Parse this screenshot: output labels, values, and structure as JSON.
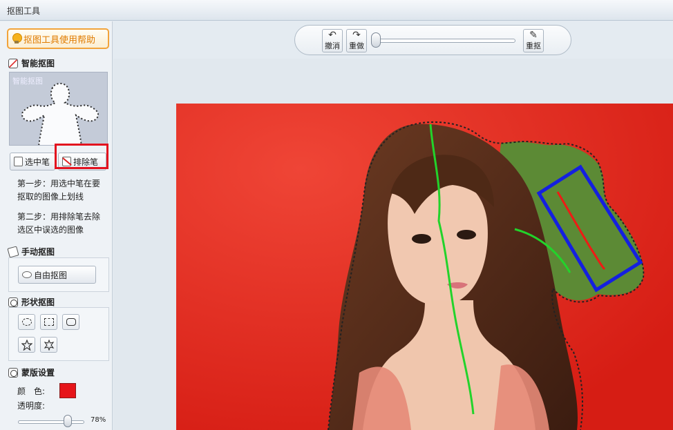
{
  "window": {
    "title": "抠图工具"
  },
  "sidebar": {
    "help_button": "抠图工具使用帮助",
    "smart": {
      "title": "智能抠图",
      "preview_label": "智能抠图",
      "select_pen": "选中笔",
      "exclude_pen": "排除笔",
      "step1": "第一步：用选中笔在要抠取的图像上划线",
      "step2": "第二步：用排除笔去除选区中误选的图像"
    },
    "manual": {
      "title": "手动抠图",
      "free_button": "自由抠图"
    },
    "shape": {
      "title": "形状抠图",
      "shapes": [
        "ellipse-icon",
        "rect-dashed-icon",
        "rounded-rect-icon",
        "star-icon",
        "star-outline-icon"
      ]
    },
    "mask": {
      "title": "蒙版设置",
      "color_label": "颜　色:",
      "color": "#e6151a",
      "opacity_label": "透明度:",
      "opacity_value": "78%",
      "opacity": 0.78
    }
  },
  "toolbar": {
    "undo": "撤消",
    "redo": "重做",
    "redraw": "重抠"
  }
}
